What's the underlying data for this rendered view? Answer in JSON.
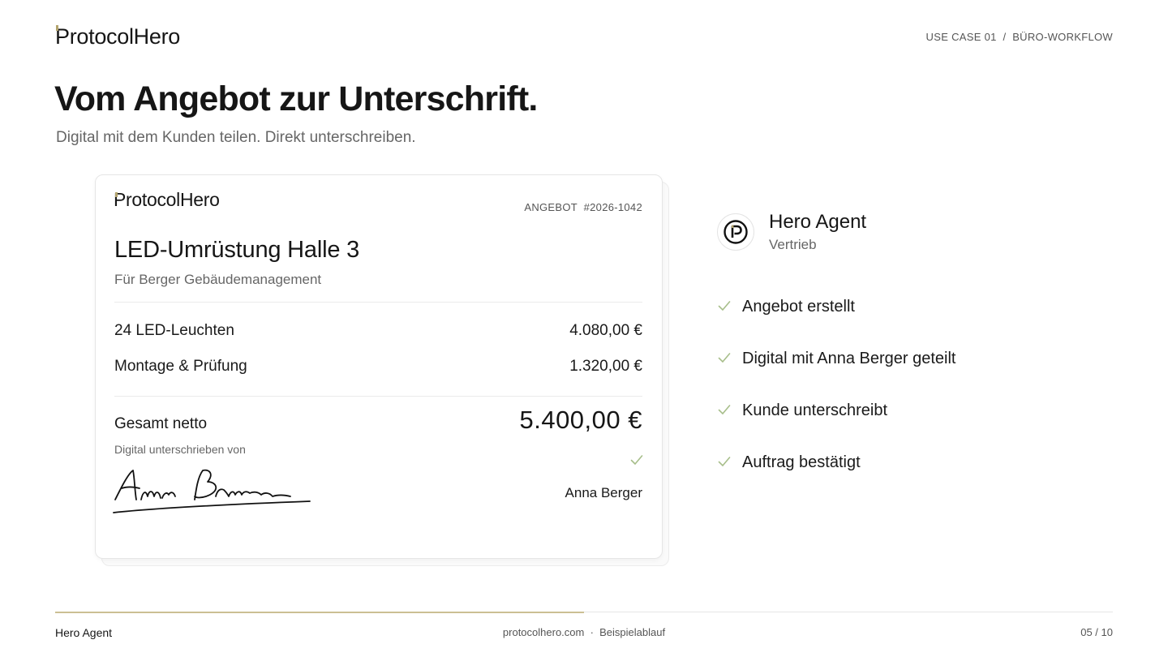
{
  "header": {
    "logo": "ProtocolHero",
    "breadcrumb": "USE CASE 01  /  BÜRO-WORKFLOW"
  },
  "hero": {
    "title": "Vom Angebot zur Unterschrift.",
    "subtitle": "Digital mit dem Kunden teilen. Direkt unterschreiben."
  },
  "offer": {
    "logo": "ProtocolHero",
    "id_label": "ANGEBOT  #2026-1042",
    "title": "LED-Umrüstung Halle 3",
    "client": "Für Berger Gebäudemanagement",
    "items": [
      {
        "label": "24 LED-Leuchten",
        "amount": "4.080,00 €"
      },
      {
        "label": "Montage & Prüfung",
        "amount": "1.320,00 €"
      }
    ],
    "total_label": "Gesamt netto",
    "total_value": "5.400,00 €",
    "signed_by_label": "Digital unterschrieben von",
    "signer": "Anna Berger"
  },
  "agent": {
    "name": "Hero Agent",
    "role": "Vertrieb",
    "steps": [
      "Angebot erstellt",
      "Digital mit Anna Berger geteilt",
      "Kunde unterschreibt",
      "Auftrag bestätigt"
    ]
  },
  "footer": {
    "left": "Hero Agent",
    "center": "protocolhero.com  ·  Beispielablauf",
    "page": "05 / 10",
    "progress": 0.5
  },
  "colors": {
    "accent": "#b3a46e",
    "check": "#a7be8a",
    "text": "#161616",
    "muted": "#666666"
  }
}
